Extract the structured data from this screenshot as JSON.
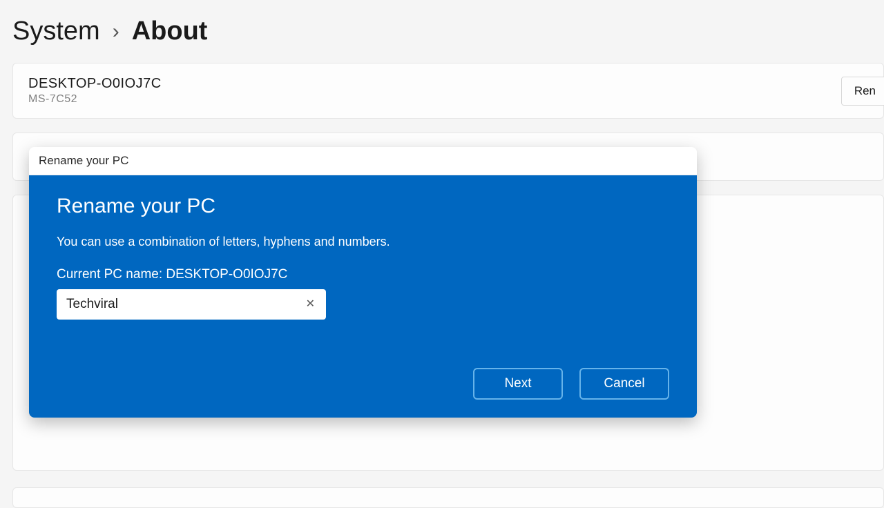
{
  "breadcrumb": {
    "parent": "System",
    "separator": "›",
    "current": "About"
  },
  "pcCard": {
    "name": "DESKTOP-O0IOJ7C",
    "model": "MS-7C52",
    "renameLabel": "Ren"
  },
  "dialog": {
    "title": "Rename your PC",
    "heading": "Rename your PC",
    "description": "You can use a combination of letters, hyphens and numbers.",
    "currentLabel": "Current PC name: DESKTOP-O0IOJ7C",
    "inputValue": "Techviral",
    "nextLabel": "Next",
    "cancelLabel": "Cancel"
  }
}
